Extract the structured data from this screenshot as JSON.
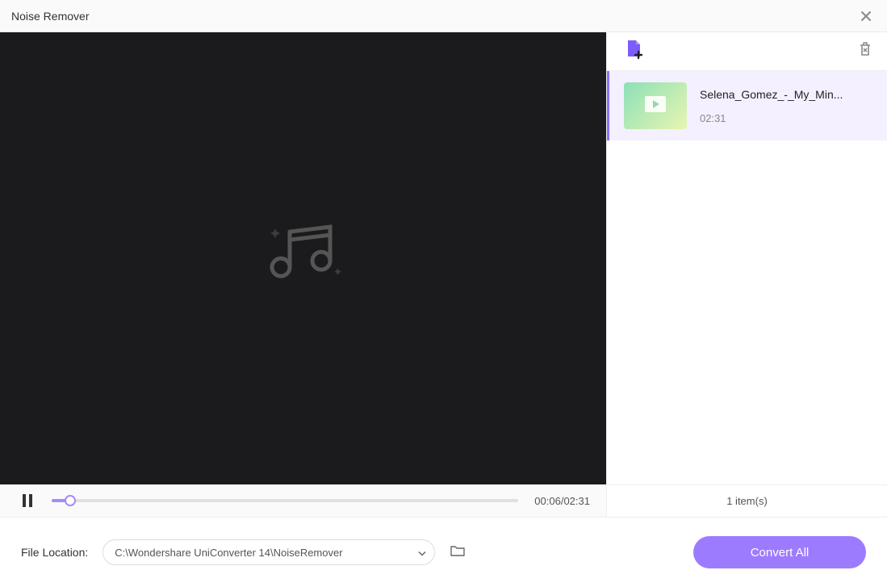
{
  "window": {
    "title": "Noise Remover"
  },
  "player": {
    "current_time": "00:06",
    "total_time": "02:31",
    "progress_percent": 4
  },
  "files": {
    "items": [
      {
        "name": "Selena_Gomez_-_My_Min...",
        "duration": "02:31"
      }
    ],
    "count_label": "1 item(s)"
  },
  "footer": {
    "location_label": "File Location:",
    "location_path": "C:\\Wondershare UniConverter 14\\NoiseRemover",
    "convert_label": "Convert All"
  }
}
